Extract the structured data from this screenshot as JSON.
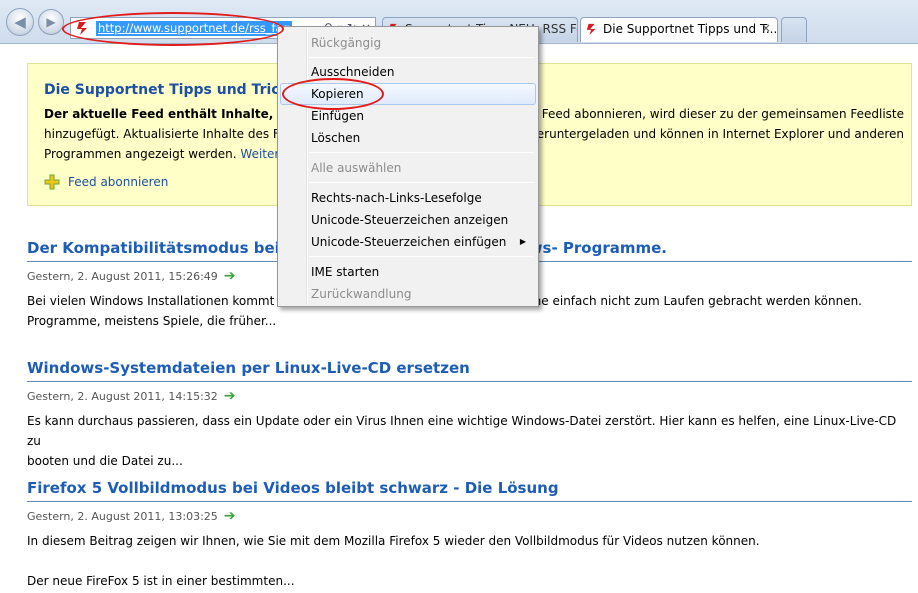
{
  "browser": {
    "address_url": "http://www.supportnet.de/rss_fag",
    "tabs": [
      {
        "label": "Supportnet Tipp: NEU: RSS Fee...",
        "active": false
      },
      {
        "label": "Die Supportnet Tipps und T...",
        "active": true
      }
    ],
    "close_glyph": "×"
  },
  "feed": {
    "title": "Die Supportnet Tipps und Tricks",
    "desc_bold": "Der aktuelle Feed enthält Inhalte, die",
    "desc_line1_rest": "Feed abonnieren, wird dieser zu der gemeinsamen Feedliste",
    "desc_line2": "hinzugefügt. Aktualisierte Inhalte des Fe",
    "desc_line2_rest": "eruntergeladen und können in Internet Explorer und anderen",
    "desc_line3": "Programmen angezeigt werden.",
    "more_link": "Weitere",
    "subscribe_label": "Feed abonnieren"
  },
  "articles": [
    {
      "title_start": "Der Kompatibilitätsmodus bei W",
      "title_end": "ows- Programme.",
      "date": "Gestern, 2. August 2011, 15:26:49",
      "body_part1": "Bei  vielen Windows  Installationen kommt",
      "body_part2": "mme einfach nicht zum Laufen gebracht werden können.",
      "body_line2": "Programme, meistens Spiele, die früher..."
    },
    {
      "title": "Windows-Systemdateien per Linux-Live-CD ersetzen",
      "date": "Gestern, 2. August 2011, 14:15:32",
      "body_line1": "Es kann durchaus passieren, dass ein Update oder ein Virus Ihnen eine wichtige Windows-Datei zerstört. Hier kann es helfen, eine Linux-Live-CD zu",
      "body_line2": "booten und die Datei zu..."
    },
    {
      "title": "Firefox 5 Vollbildmodus bei Videos bleibt schwarz - Die Lösung",
      "date": "Gestern, 2. August 2011, 13:03:25",
      "body_line1": "In diesem Beitrag zeigen wir Ihnen, wie Sie mit dem Mozilla Firefox 5 wieder den Vollbildmodus für Videos nutzen können.",
      "body_line2": "Der neue FireFox 5 ist in einer bestimmten..."
    }
  ],
  "context_menu": {
    "items": [
      {
        "label": "Rückgängig",
        "enabled": false
      },
      {
        "label": "Ausschneiden",
        "enabled": true
      },
      {
        "label": "Kopieren",
        "enabled": true,
        "highlighted": true
      },
      {
        "label": "Einfügen",
        "enabled": true
      },
      {
        "label": "Löschen",
        "enabled": true
      },
      {
        "label": "Alle auswählen",
        "enabled": false
      },
      {
        "label": "Rechts-nach-Links-Lesefolge",
        "enabled": true
      },
      {
        "label": "Unicode-Steuerzeichen anzeigen",
        "enabled": true
      },
      {
        "label": "Unicode-Steuerzeichen einfügen",
        "enabled": true,
        "submenu": true
      },
      {
        "label": "IME starten",
        "enabled": true
      },
      {
        "label": "Zurückwandlung",
        "enabled": false
      }
    ],
    "submenu_arrow": "▶"
  },
  "colors": {
    "link_blue": "#1d5db5",
    "annotation_red": "#e21b1b",
    "feed_box_bg": "#ffffc8",
    "selection_blue": "#3399ff"
  }
}
